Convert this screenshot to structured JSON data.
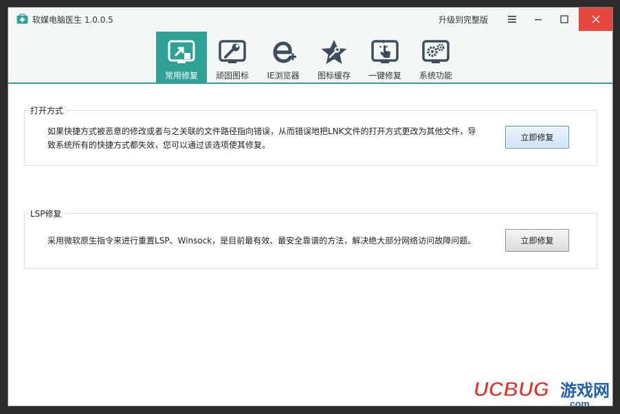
{
  "titlebar": {
    "title": "软媒电脑医生 1.0.0.5",
    "upgrade_label": "升级到完整版"
  },
  "toolbar": {
    "items": [
      {
        "label": "常用修复",
        "icon": "window-pointer-icon",
        "active": true
      },
      {
        "label": "顽固图标",
        "icon": "window-wrench-icon",
        "active": false
      },
      {
        "label": "IE浏览器",
        "icon": "ie-plus-icon",
        "active": false
      },
      {
        "label": "图标缓存",
        "icon": "star-wrench-icon",
        "active": false
      },
      {
        "label": "一键修复",
        "icon": "hand-click-icon",
        "active": false
      },
      {
        "label": "系统功能",
        "icon": "gears-window-icon",
        "active": false
      }
    ]
  },
  "groups": [
    {
      "title": "打开方式",
      "desc_line1": "如果快捷方式被恶意的修改或者与之关联的文件路径指向错误，从而错误地把LNK文件的打开方式更改为其他文件，导",
      "desc_line2": "致系统所有的快捷方式都失效，您可以通过该选项使其修复。",
      "button_label": "立即修复"
    },
    {
      "title": "LSP修复",
      "desc_line1": "采用微软原生指令来进行重置LSP、Winsock，是目前最有效、最安全靠谱的方法，解决绝大部分网络访问故障问题。",
      "button_label": "立即修复"
    }
  ],
  "watermark": {
    "brand": "UCBUG",
    "cn": "游戏网",
    "suffix": ".com"
  },
  "colors": {
    "accent": "#30a195",
    "close": "#e8463c",
    "icon_dark": "#3c4e5e",
    "watermark_red": "#e8312a",
    "watermark_blue": "#1f5fb3"
  }
}
